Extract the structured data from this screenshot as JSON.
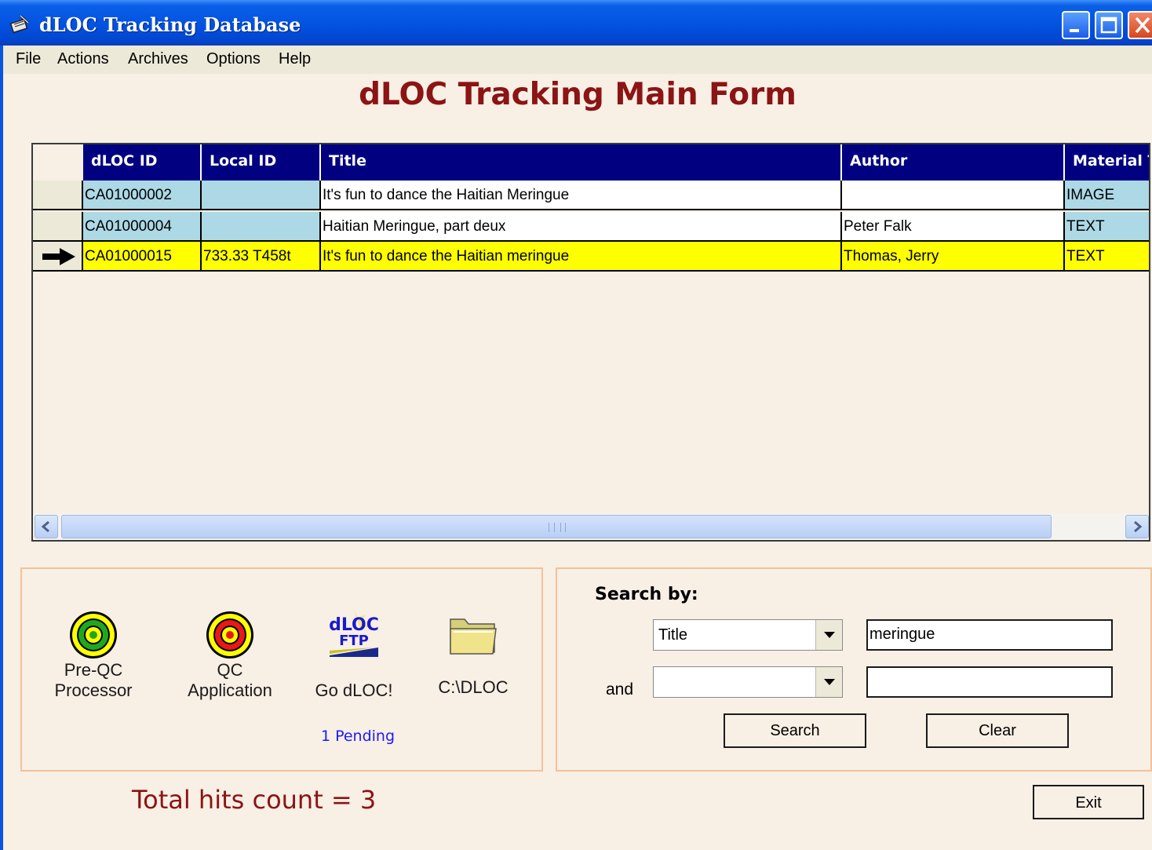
{
  "window": {
    "title": "dLOC Tracking Database",
    "controls": [
      "minimize",
      "maximize",
      "close"
    ]
  },
  "menu": [
    "File",
    "Actions",
    "Archives",
    "Options",
    "Help"
  ],
  "form_title": "dLOC Tracking Main Form",
  "grid": {
    "columns": [
      "dLOC ID",
      "Local ID",
      "Title",
      "Author",
      "Material T"
    ],
    "rows": [
      {
        "dloc_id": "CA01000002",
        "local_id": "",
        "title": "It's fun to dance the Haitian Meringue",
        "author": "",
        "material": "IMAGE",
        "selected": false
      },
      {
        "dloc_id": "CA01000004",
        "local_id": "",
        "title": "Haitian Meringue, part deux",
        "author": "Peter Falk",
        "material": "TEXT",
        "selected": false
      },
      {
        "dloc_id": "CA01000015",
        "local_id": "733.33 T458t",
        "title": "It's fun to dance the Haitian meringue",
        "author": "Thomas, Jerry",
        "material": "TEXT",
        "selected": true
      }
    ]
  },
  "launchers": [
    {
      "line1": "Pre-QC",
      "line2": "Processor",
      "icon": "target-green-icon"
    },
    {
      "line1": "QC",
      "line2": "Application",
      "icon": "target-red-icon"
    },
    {
      "line1": "",
      "line2": "Go dLOC!",
      "icon": "dloc-ftp-icon",
      "icon_text_top": "dLOC",
      "icon_text_bottom": "FTP"
    },
    {
      "line1": "",
      "line2": "C:\\DLOC",
      "icon": "folder-icon"
    }
  ],
  "pending": "1 Pending",
  "search": {
    "heading": "Search by:",
    "field1": "Title",
    "value1": "meringue",
    "and_label": "and",
    "field2": "",
    "value2": "",
    "search_label": "Search",
    "clear_label": "Clear"
  },
  "total_hits": "Total hits count = 3",
  "exit_label": "Exit",
  "colors": {
    "header_bg": "#000080",
    "title_red": "#8b1414",
    "selected_row": "#ffff00",
    "id_cell": "#add8e6",
    "form_bg": "#f8efe5"
  }
}
